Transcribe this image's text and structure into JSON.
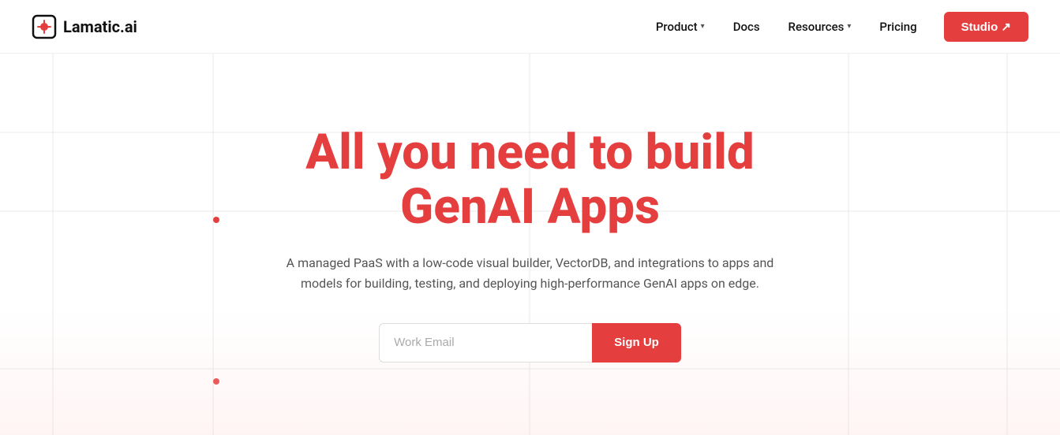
{
  "nav": {
    "logo_text": "Lamatic.ai",
    "links": [
      {
        "label": "Product",
        "has_dropdown": true
      },
      {
        "label": "Docs",
        "has_dropdown": false
      },
      {
        "label": "Resources",
        "has_dropdown": true
      },
      {
        "label": "Pricing",
        "has_dropdown": false
      }
    ],
    "studio_label": "Studio ↗"
  },
  "hero": {
    "title_line1": "All you need to build",
    "title_line2": "GenAI Apps",
    "subtitle": "A managed PaaS with a low-code visual builder, VectorDB, and integrations to apps and models for building, testing, and deploying high-performance GenAI apps on edge.",
    "email_placeholder": "Work Email",
    "signup_label": "Sign Up"
  },
  "colors": {
    "accent": "#e53e3e",
    "text_dark": "#111111",
    "text_muted": "#555555"
  }
}
